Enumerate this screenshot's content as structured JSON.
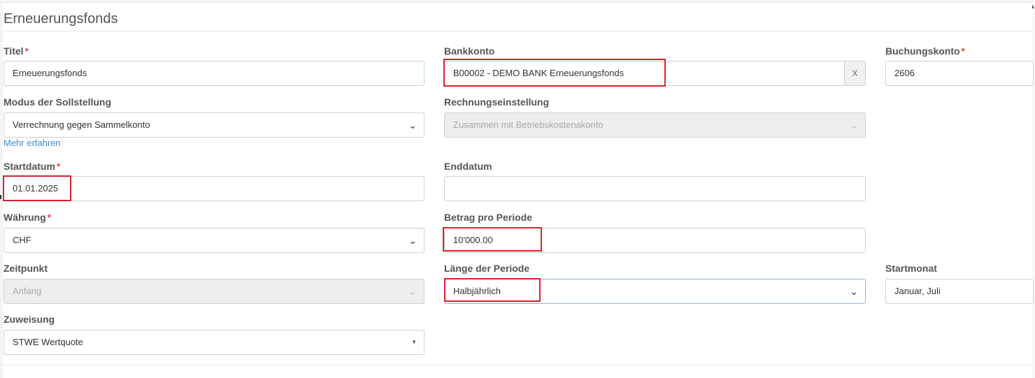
{
  "section_title": "Erneuerungsfonds",
  "required_mark": "*",
  "fields": {
    "titel": {
      "label": "Titel",
      "value": "Erneuerungsfonds"
    },
    "bankkonto": {
      "label": "Bankkonto",
      "value": "B00002 - DEMO BANK Erneuerungsfonds",
      "clear_label": "X"
    },
    "buchungskonto": {
      "label": "Buchungskonto",
      "value": "2606"
    },
    "modus": {
      "label": "Modus der Sollstellung",
      "value": "Verrechnung gegen Sammelkonto",
      "help_link": "Mehr erfahren"
    },
    "rechnungseinstellung": {
      "label": "Rechnungseinstellung",
      "value": "Zusammen mit Betriebskostenakonto"
    },
    "startdatum": {
      "label": "Startdatum",
      "value": "01.01.2025"
    },
    "enddatum": {
      "label": "Enddatum",
      "value": ""
    },
    "waehrung": {
      "label": "Währung",
      "value": "CHF"
    },
    "betrag": {
      "label": "Betrag pro Periode",
      "value": "10'000.00"
    },
    "zeitpunkt": {
      "label": "Zeitpunkt",
      "value": "Anfang"
    },
    "laenge": {
      "label": "Länge der Periode",
      "value": "Halbjährlich"
    },
    "startmonat": {
      "label": "Startmonat",
      "value": "Januar, Juli"
    },
    "zuweisung": {
      "label": "Zuweisung",
      "value": "STWE Wertquote"
    }
  },
  "icons": {
    "select_chevron": "chevron-down-icon",
    "dropdown_caret": "caret-down-icon",
    "scroll_up": "scroll-up-arrow-icon"
  },
  "colors": {
    "highlight": "#d9232d",
    "required": "#d9534f",
    "link": "#3a8dd6",
    "focus_border": "#8fb3e0"
  }
}
